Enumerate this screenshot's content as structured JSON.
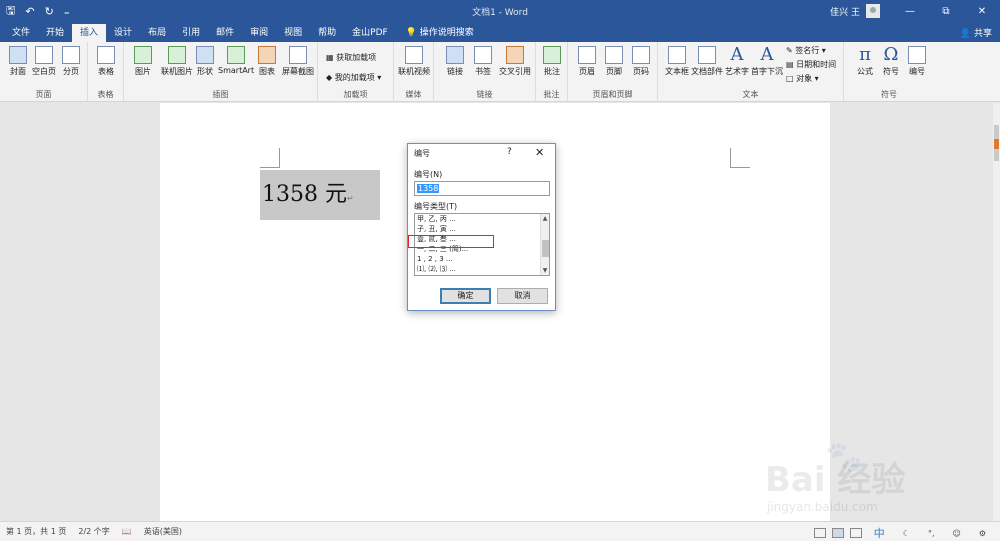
{
  "titlebar": {
    "qat_save": "🖫",
    "qat_undo": "↶",
    "qat_redo": "↻",
    "qat_more": "₌",
    "title": "文档1 - Word",
    "user": "佳兴 王",
    "minimize": "—",
    "restore": "⧉",
    "close": "✕"
  },
  "tabs": [
    "文件",
    "开始",
    "插入",
    "设计",
    "布局",
    "引用",
    "邮件",
    "审阅",
    "视图",
    "帮助",
    "金山PDF"
  ],
  "active_tab": "插入",
  "tell_me": "操作说明搜索",
  "share": "共享",
  "ribbon": {
    "pages": {
      "label": "页面",
      "cover": "封面",
      "blank": "空白页",
      "break": "分页"
    },
    "tables": {
      "label": "表格",
      "table": "表格"
    },
    "illustrations": {
      "label": "插图",
      "picture": "图片",
      "online_picture": "联机图片",
      "shapes": "形状",
      "smartart": "SmartArt",
      "chart": "图表",
      "screenshot": "屏幕截图"
    },
    "addins": {
      "label": "加载项",
      "get": "获取加载项",
      "my": "我的加载项"
    },
    "media": {
      "label": "媒体",
      "online_video": "联机视频"
    },
    "links": {
      "label": "链接",
      "link": "链接",
      "bookmark": "书签",
      "crossref": "交叉引用"
    },
    "comments": {
      "label": "批注",
      "comment": "批注"
    },
    "header_footer": {
      "label": "页眉和页脚",
      "header": "页眉",
      "footer": "页脚",
      "page_number": "页码"
    },
    "text": {
      "label": "文本",
      "textbox": "文本框",
      "quickparts": "文档部件",
      "wordart": "艺术字",
      "dropcap": "首字下沉",
      "signature": "签名行",
      "datetime": "日期和时间",
      "object": "对象"
    },
    "symbols": {
      "label": "符号",
      "equation": "公式",
      "symbol": "符号",
      "numbering": "编号"
    }
  },
  "document": {
    "text": "1358 元",
    "para_mark": "↵"
  },
  "dialog": {
    "title": "编号",
    "help": "?",
    "close": "✕",
    "number_label": "编号(N)",
    "number_value": "1358",
    "type_label": "编号类型(T)",
    "types": [
      "甲, 乙, 丙 ...",
      "子, 丑, 寅 ...",
      "壹, 贰, 叁 ...",
      "一, 二, 三 (简)...",
      "1 , 2 , 3 ...",
      "⑴, ⑵, ⑶ ..."
    ],
    "selected_type_index": 2,
    "ok": "确定",
    "cancel": "取消"
  },
  "statusbar": {
    "page": "第 1 页，共 1 页",
    "words": "2/2 个字",
    "lang": "英语(美国)"
  },
  "ime": {
    "mode": "中"
  },
  "watermark": {
    "brand": "Bai 经验",
    "url": "jingyan.baidu.com"
  },
  "colors": {
    "accent": "#2b579a",
    "highlight_box": "#e0242b",
    "selection": "#3399ff"
  }
}
